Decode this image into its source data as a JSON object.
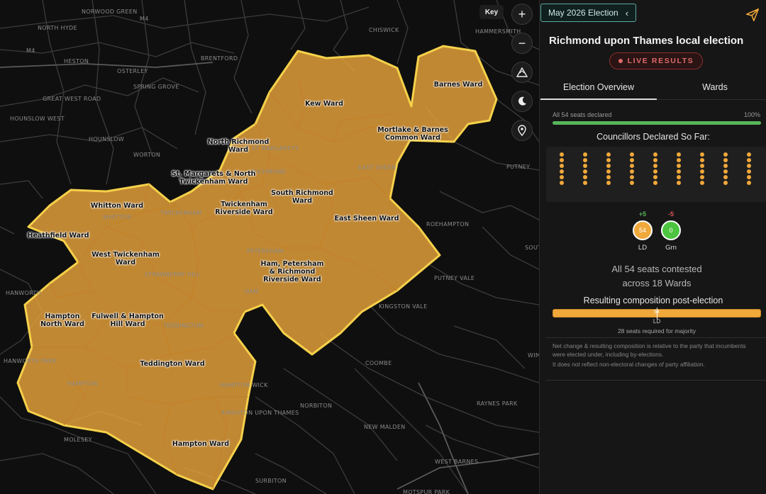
{
  "map": {
    "key_label": "Key",
    "place_labels": [
      "NORWOOD GREEN",
      "NORTH HYDE",
      "M4",
      "M4",
      "HESTON",
      "OSTERLEY",
      "BRENTFORD",
      "SPRING GROVE",
      "GREAT WEST ROAD",
      "HOUNSLOW WEST",
      "HOUNSLOW",
      "WORTON",
      "WHITTON",
      "ST MARGARETS",
      "RICHMOND",
      "EAST SHEEN",
      "CHISWICK",
      "HAMMERSMITH",
      "PUTNEY",
      "ROEHAMPTON",
      "PETERSHAM",
      "TWICKENHAM",
      "STRAWBERRY HILL",
      "HAM",
      "TEDDINGTON",
      "HAMPTON",
      "HAMPTON WICK",
      "KINGSTON UPON THAMES",
      "PUTNEY VALE",
      "KINGSTON VALE",
      "COOMBE",
      "NORBITON",
      "NEW MALDEN",
      "RAYNES PARK",
      "WEST BARNES",
      "MOLESEY",
      "SURBITON",
      "MOTSPUR PARK",
      "HANWORTH",
      "HANWORTH PARK",
      "SOUTHFIELDS",
      "WIMBLEDON"
    ],
    "ward_labels": [
      [
        "Barnes Ward"
      ],
      [
        "Kew Ward"
      ],
      [
        "Mortlake & Barnes",
        "Common Ward"
      ],
      [
        "North Richmond",
        "Ward"
      ],
      [
        "St. Margarets & North",
        "Twickenham Ward"
      ],
      [
        "South Richmond",
        "Ward"
      ],
      [
        "Twickenham",
        "Riverside Ward"
      ],
      [
        "Whitton Ward"
      ],
      [
        "East Sheen Ward"
      ],
      [
        "Heathfield Ward"
      ],
      [
        "West Twickenham",
        "Ward"
      ],
      [
        "Ham, Petersham",
        "& Richmond",
        "Riverside Ward"
      ],
      [
        "Hampton",
        "North Ward"
      ],
      [
        "Fulwell & Hampton",
        "Hill Ward"
      ],
      [
        "Teddington Ward"
      ],
      [
        "Hampton Ward"
      ]
    ],
    "colors": {
      "ward_fill": "#e9a33c",
      "ward_border": "#f5d14a",
      "background": "#0f0f0f",
      "roads": "#3a3a3a"
    },
    "controls": [
      "zoom-in-icon",
      "zoom-out-icon",
      "terrain-icon",
      "moon-icon",
      "location-pin-icon"
    ]
  },
  "panel": {
    "election_button": "May 2026 Election",
    "title": "Richmond upon Thames local election",
    "live_badge": "LIVE RESULTS",
    "tabs": [
      "Election Overview",
      "Wards"
    ],
    "seats_declared_text": "All 54 seats declared",
    "seats_declared_pct": "100%",
    "declared_fraction": 1.0,
    "councillors_title": "Councillors Declared So Far:",
    "councillors_declared": 54,
    "parties": [
      {
        "name": "LD",
        "seats": "54",
        "change": "+5",
        "color": "#f0a83a",
        "change_color": "#57b65a"
      },
      {
        "name": "Grn",
        "seats": "0",
        "change": "-5",
        "color": "#4cc43f",
        "change_color": "#e05555"
      }
    ],
    "contested_line1": "All 54 seats contested",
    "contested_line2": "across 18 Wards",
    "composition_title": "Resulting composition post-election",
    "composition_value": "54",
    "composition_party": "LD",
    "majority_text": "28 seats required for majority",
    "note1": "Net change & resulting composition is relative to the party that incumbents were elected under, including by-elections.",
    "note2": "It does not reflect non-electoral changes of party affiliation."
  }
}
